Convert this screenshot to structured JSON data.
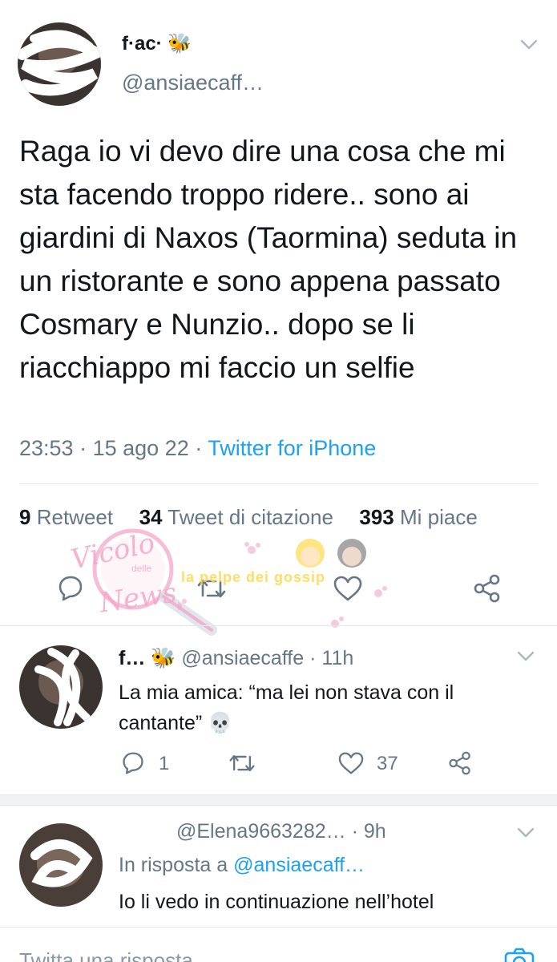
{
  "main_tweet": {
    "name": "f·ac· 🐝",
    "handle": "@ansiaecaff…",
    "text": "Raga io vi devo dire una cosa che mi sta facendo troppo ridere.. sono ai giardini di Naxos (Taormina) seduta in un ristorante e sono appena passato Cosmary e Nunzio.. dopo se li riacchiappo mi faccio un selfie",
    "time": "23:53",
    "date": "15 ago 22",
    "source": "Twitter for iPhone",
    "stats": {
      "retweets_count": "9",
      "retweets_label": "Retweet",
      "quotes_count": "34",
      "quotes_label": "Tweet di citazione",
      "likes_count": "393",
      "likes_label": "Mi piace"
    }
  },
  "reply_1": {
    "name": "f… 🐝",
    "handle": "@ansiaecaffe",
    "time": "11h",
    "text": "La mia amica: “ma lei non stava con il cantante” 💀",
    "reply_count": "1",
    "like_count": "37"
  },
  "reply_2": {
    "handle": "@Elena9663282…",
    "time": "9h",
    "in_reply_prefix": "In risposta a",
    "in_reply_handle": "@ansiaecaff…",
    "text": "Io li vedo in continuazione nell’hotel"
  },
  "composer": {
    "placeholder": "Twitta una risposta"
  },
  "watermarks": {
    "vicolo_line1": "Vicolo",
    "vicolo_line2": "delle",
    "vicolo_line3": "News",
    "pelpe": "la pelpe dei gossip"
  },
  "colors": {
    "link": "#1da1f2",
    "muted": "#657786",
    "divider": "#e1e8ed",
    "watermark_pink": "#f4a6c8",
    "watermark_yellow": "#ffd84a"
  }
}
